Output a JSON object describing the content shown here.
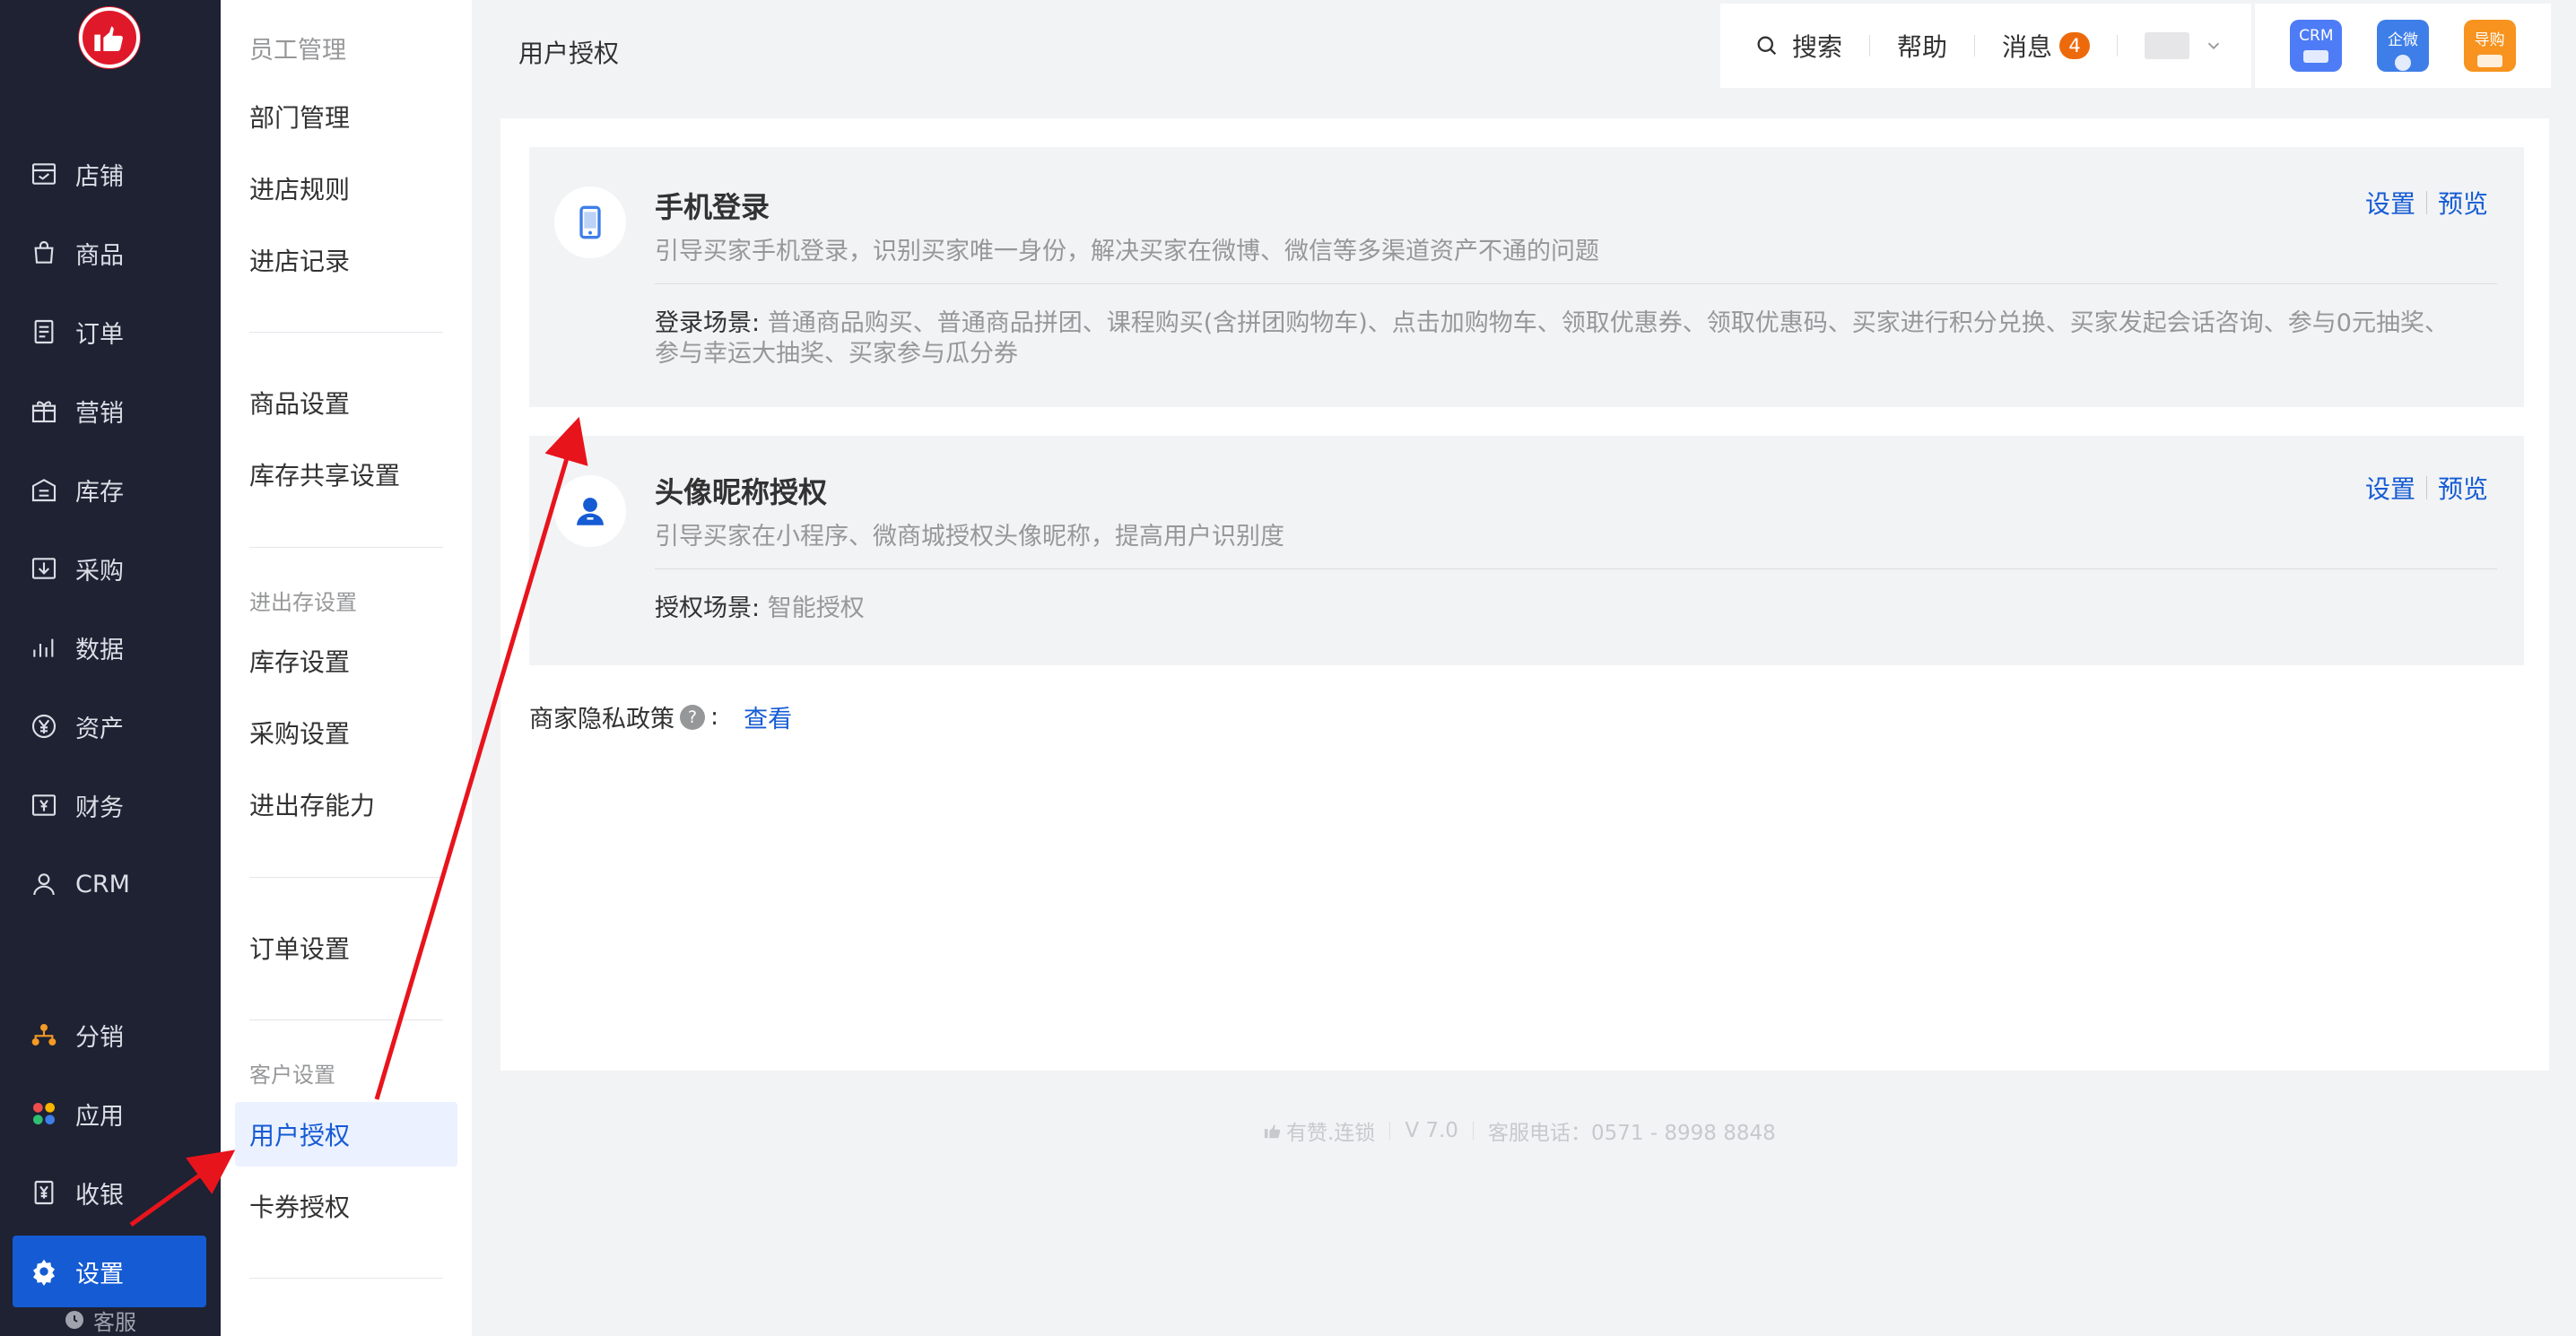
{
  "primary_nav": {
    "items": [
      {
        "label": "店铺",
        "icon": "store-icon"
      },
      {
        "label": "商品",
        "icon": "bag-icon"
      },
      {
        "label": "订单",
        "icon": "order-icon"
      },
      {
        "label": "营销",
        "icon": "gift-icon"
      },
      {
        "label": "库存",
        "icon": "warehouse-icon"
      },
      {
        "label": "采购",
        "icon": "purchase-icon"
      },
      {
        "label": "数据",
        "icon": "chart-icon"
      },
      {
        "label": "资产",
        "icon": "yuan-circle-icon"
      },
      {
        "label": "财务",
        "icon": "finance-icon"
      },
      {
        "label": "CRM",
        "icon": "user-icon"
      },
      {
        "label": "分销",
        "icon": "distribution-icon"
      },
      {
        "label": "应用",
        "icon": "apps-icon"
      },
      {
        "label": "收银",
        "icon": "cashier-icon"
      },
      {
        "label": "设置",
        "icon": "gear-icon"
      },
      {
        "label": "客服",
        "icon": "service-icon"
      }
    ]
  },
  "secondary_nav": {
    "top_label": "员工管理",
    "items": {
      "dept": "部门管理",
      "entry_rules": "进店规则",
      "entry_records": "进店记录",
      "goods_settings": "商品设置",
      "stock_share": "库存共享设置",
      "stock_settings": "库存设置",
      "purchase_settings": "采购设置",
      "inventory_ability": "进出存能力",
      "order_settings": "订单设置",
      "user_auth": "用户授权",
      "coupon_auth": "卡券授权"
    },
    "groups": {
      "inventory": "进出存设置",
      "customer": "客户设置"
    }
  },
  "header": {
    "page_title": "用户授权",
    "search": "搜索",
    "help": "帮助",
    "messages": "消息",
    "message_count": "4",
    "apps": [
      {
        "label": "CRM",
        "color": "#4d7cf6"
      },
      {
        "label": "企微",
        "color": "#3e7ee8"
      },
      {
        "label": "导购",
        "color": "#f7931e"
      }
    ]
  },
  "cards": [
    {
      "title": "手机登录",
      "desc": "引导买家手机登录，识别买家唯一身份，解决买家在微博、微信等多渠道资产不通的问题",
      "scene_label": "登录场景:",
      "scene_text": "普通商品购买、普通商品拼团、课程购买(含拼团购物车)、点击加购物车、领取优惠券、领取优惠码、买家进行积分兑换、买家发起会话咨询、参与0元抽奖、参与幸运大抽奖、买家参与瓜分券",
      "settings": "设置",
      "preview": "预览"
    },
    {
      "title": "头像昵称授权",
      "desc": "引导买家在小程序、微商城授权头像昵称，提高用户识别度",
      "scene_label": "授权场景:",
      "scene_text": "智能授权",
      "settings": "设置",
      "preview": "预览"
    }
  ],
  "privacy": {
    "label": "商家隐私政策",
    "colon": ":",
    "link": "查看"
  },
  "footer": {
    "brand": "有赞.连锁",
    "version": "V 7.0",
    "phone": "客服电话：0571 - 8998 8848"
  },
  "colors": {
    "accent": "#155bd4",
    "sidebar_bg": "#1e2233",
    "annotation_arrow": "#e8141c"
  }
}
